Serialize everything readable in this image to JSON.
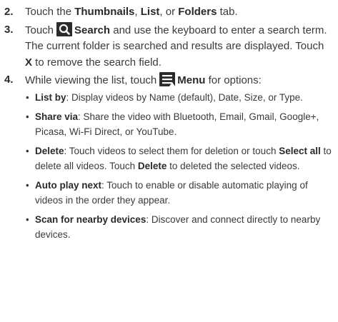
{
  "steps": [
    {
      "number": "2.",
      "parts": [
        "Touch the ",
        "Thumbnails",
        ", ",
        "List",
        ", or ",
        "Folders",
        " tab."
      ]
    },
    {
      "number": "3.",
      "icon": "search-icon",
      "parts": [
        "Touch",
        "Search",
        " and use the keyboard to enter a search term. The current folder is searched and results are displayed. Touch ",
        "X",
        " to remove the search field."
      ]
    },
    {
      "number": "4.",
      "icon": "menu-icon",
      "parts": [
        "While viewing the list, touch",
        "Menu",
        " for options:"
      ]
    }
  ],
  "bullets": [
    {
      "term": "List by",
      "text": ": Display videos by Name (default), Date, Size, or Type."
    },
    {
      "term": "Share via",
      "text": ": Share the video with Bluetooth, Email, Gmail, Google+, Picasa, Wi-Fi Direct, or YouTube."
    },
    {
      "term": "Delete",
      "text": ": Touch videos to select them for deletion or touch ",
      "term2": "Select all",
      "text2": " to delete all videos. Touch ",
      "term3": "Delete",
      "text3": " to deleted the selected videos."
    },
    {
      "term": "Auto play next",
      "text": ": Touch to enable or disable automatic playing of videos in the order they appear."
    },
    {
      "term": "Scan for nearby devices",
      "text": ": Discover and connect directly to nearby devices."
    }
  ]
}
